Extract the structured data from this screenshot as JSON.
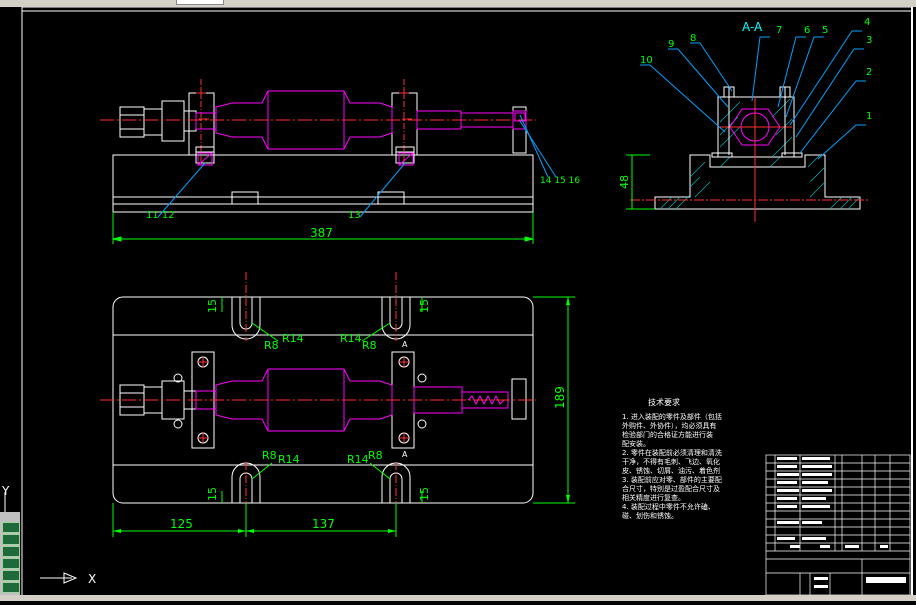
{
  "colors": {
    "background": "#000000",
    "frame": "#ffffff",
    "part": "#ffffff",
    "shaft": "#ff00ff",
    "center": "#ff3030",
    "dimension": "#00ff00",
    "leader": "#00a0ff",
    "section_text": "#00ffff",
    "hatch": "#00c0c0"
  },
  "section": {
    "title": "A-A",
    "balloons": [
      "10",
      "9",
      "8",
      "7",
      "6",
      "5",
      "4",
      "3",
      "2",
      "1"
    ],
    "dim_height": "48"
  },
  "front_view": {
    "balloons_left": "11 12",
    "balloon_mid": "13",
    "balloons_right": "14 15 16",
    "dim_length": "387"
  },
  "plan_view": {
    "slot_dim": "15",
    "r8": "R8",
    "r14": "R14",
    "section_mark": "A",
    "dim_width": "189",
    "dim_left": "125",
    "dim_mid": "137"
  },
  "notes": {
    "title": "技术要求",
    "lines": [
      "1. 进入装配的零件及部件（包括",
      "外购件、外协件），均必须具有",
      "检验部门的合格证方能进行装",
      "配安装。",
      "2. 零件在装配前必须清理和清洗",
      "干净，不得有毛刺、飞边、氧化",
      "皮、锈蚀、切屑、油污、着色剂",
      "3. 装配前应对零、部件的主要配",
      "合尺寸，特别是过盈配合尺寸及",
      "相关精度进行复查。",
      "4. 装配过程中零件不允许磕、",
      "碰、划伤和锈蚀。"
    ]
  },
  "ucs": {
    "x": "X",
    "y": "Y"
  }
}
